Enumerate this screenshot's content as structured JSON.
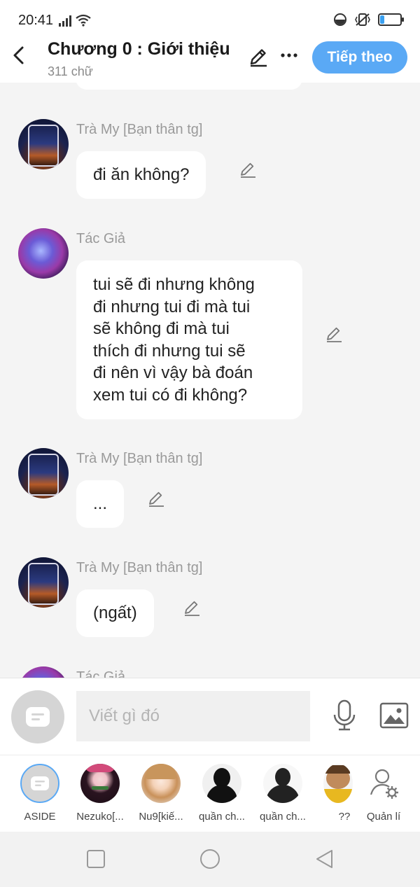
{
  "status_bar": {
    "time": "20:41",
    "icons": [
      "signal-icon",
      "wifi-icon",
      "alarm-icon",
      "vibrate-icon",
      "battery-icon"
    ],
    "battery_level": 0.2,
    "battery_color": "#3aa0f0"
  },
  "header": {
    "title": "Chương 0 : Giới thiệu",
    "word_count": "311 chữ",
    "next_label": "Tiếp theo",
    "accent_color": "#5aa9f5"
  },
  "messages": [
    {
      "sender": "Trà My [Bạn thân tg]",
      "avatar": "tramy",
      "text": "đi ăn không?"
    },
    {
      "sender": "Tác Giả",
      "avatar": "tacgia",
      "text": "tui sẽ đi nhưng không\nđi nhưng tui đi mà tui\nsẽ không đi mà tui\nthích đi nhưng tui sẽ\nđi nên vì vậy bà đoán\nxem tui có đi không?"
    },
    {
      "sender": "Trà My [Bạn thân tg]",
      "avatar": "tramy",
      "text": "..."
    },
    {
      "sender": "Trà My [Bạn thân tg]",
      "avatar": "tramy",
      "text": "(ngất)"
    },
    {
      "sender": "Tác Giả",
      "avatar": "tacgia",
      "text": ""
    }
  ],
  "input": {
    "placeholder": "Viết gì đó"
  },
  "characters": [
    {
      "label": "ASIDE"
    },
    {
      "label": "Nezuko[..."
    },
    {
      "label": "Nu9[kiế..."
    },
    {
      "label": "quần ch..."
    },
    {
      "label": "quần ch..."
    },
    {
      "label": "??"
    },
    {
      "label": "Quản lí"
    }
  ]
}
